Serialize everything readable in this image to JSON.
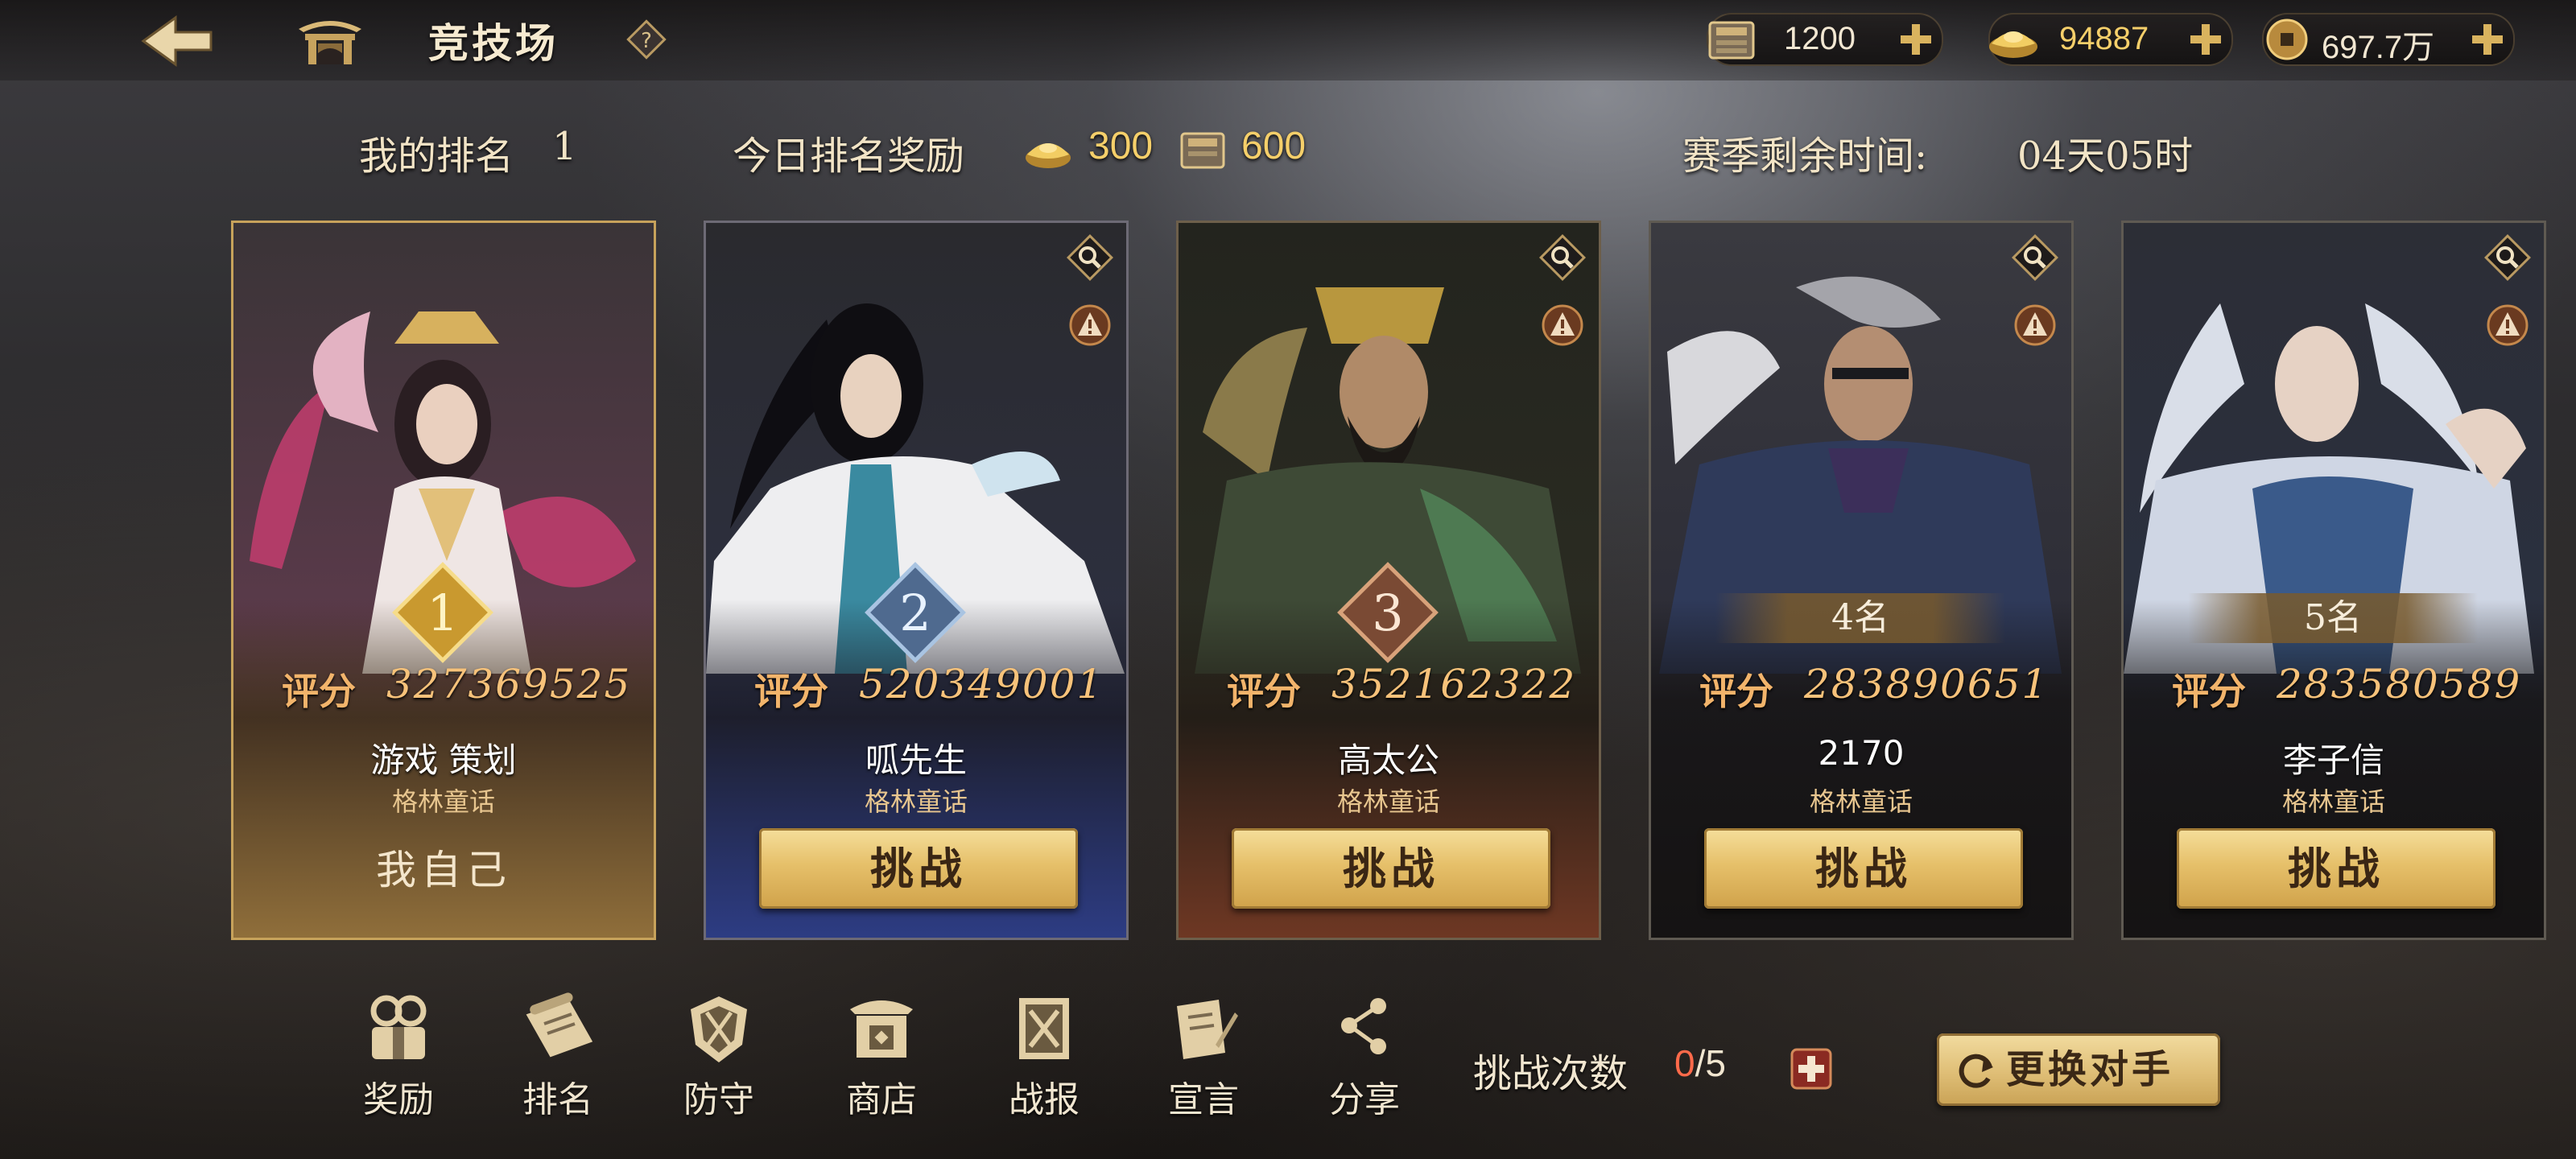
{
  "header": {
    "title": "竞技场",
    "icons": {
      "back": "back-arrow-icon",
      "arena": "arena-gate-icon",
      "help": "help-icon"
    }
  },
  "currencies": [
    {
      "name": "book",
      "icon": "book-currency-icon",
      "value": "1200"
    },
    {
      "name": "gold",
      "icon": "gold-ingot-icon",
      "value": "94887"
    },
    {
      "name": "coin",
      "icon": "copper-coin-icon",
      "value": "697.7万"
    }
  ],
  "info": {
    "my_rank_label": "我的排名",
    "my_rank": "1",
    "reward_label": "今日排名奖励",
    "reward_gold": "300",
    "reward_books": "600",
    "season_label": "赛季剩余时间:",
    "season_remaining": "04天05时"
  },
  "score_label": "评分",
  "challenge_label": "挑战",
  "cards": [
    {
      "rank": "1",
      "rank_text": "",
      "score": "327369525",
      "name": "游戏  策划",
      "guild": "格林童话",
      "is_self": true,
      "self_label": "我自己",
      "frame": "#c7a25b"
    },
    {
      "rank": "2",
      "rank_text": "",
      "score": "520349001",
      "name": "呱先生",
      "guild": "格林童话",
      "is_self": false,
      "frame": "#3c4f92"
    },
    {
      "rank": "3",
      "rank_text": "",
      "score": "352162322",
      "name": "高太公",
      "guild": "格林童话",
      "is_self": false,
      "frame": "#8a4a34"
    },
    {
      "rank": "4",
      "rank_text": "4名",
      "score": "283890651",
      "name": "2170",
      "guild": "格林童话",
      "is_self": false,
      "frame": "#55504a"
    },
    {
      "rank": "5",
      "rank_text": "5名",
      "score": "283580589",
      "name": "李子信",
      "guild": "格林童话",
      "is_self": false,
      "frame": "#55504a"
    }
  ],
  "nav": [
    {
      "label": "奖励",
      "icon": "reward-icon"
    },
    {
      "label": "排名",
      "icon": "ranking-scroll-icon"
    },
    {
      "label": "防守",
      "icon": "defense-icon"
    },
    {
      "label": "商店",
      "icon": "shop-icon"
    },
    {
      "label": "战报",
      "icon": "battle-report-icon"
    },
    {
      "label": "宣言",
      "icon": "declaration-icon"
    },
    {
      "label": "分享",
      "icon": "share-icon"
    }
  ],
  "attempts": {
    "label": "挑战次数",
    "used": "0",
    "total": "/5"
  },
  "change_opponent_label": "更换对手",
  "colors": {
    "gold_text": "#f7c27a",
    "accent_gold": "#e6c06a",
    "attempts_used": "#ff6a4a"
  }
}
